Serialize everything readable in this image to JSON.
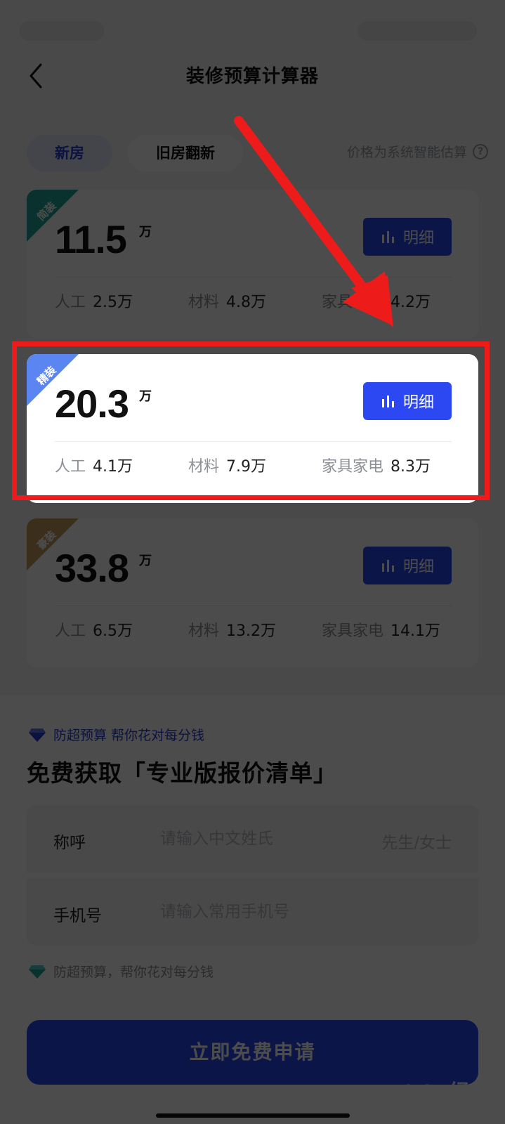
{
  "header": {
    "title": "装修预算计算器"
  },
  "tabs": [
    {
      "label": "新房"
    },
    {
      "label": "旧房翻新"
    }
  ],
  "hint": {
    "text": "价格为系统智能估算",
    "icon": "help-circle-icon"
  },
  "plans": [
    {
      "badge": "简装",
      "badge_color": "#1fa79d",
      "amount": "11.5",
      "unit": "万",
      "detail_label": "明细",
      "items": [
        {
          "label": "人工",
          "value": "2.5万"
        },
        {
          "label": "材料",
          "value": "4.8万"
        },
        {
          "label": "家具家电",
          "value": "4.2万"
        }
      ]
    },
    {
      "badge": "精装",
      "badge_color": "#5b86f2",
      "amount": "20.3",
      "unit": "万",
      "detail_label": "明细",
      "items": [
        {
          "label": "人工",
          "value": "4.1万"
        },
        {
          "label": "材料",
          "value": "7.9万"
        },
        {
          "label": "家具家电",
          "value": "8.3万"
        }
      ]
    },
    {
      "badge": "豪装",
      "badge_color": "#c59a5a",
      "amount": "33.8",
      "unit": "万",
      "detail_label": "明细",
      "items": [
        {
          "label": "人工",
          "value": "6.5万"
        },
        {
          "label": "材料",
          "value": "13.2万"
        },
        {
          "label": "家具家电",
          "value": "14.1万"
        }
      ]
    }
  ],
  "form": {
    "promo": "防超预算 帮你花对每分钱",
    "title": "免费获取「专业版报价清单」",
    "name": {
      "label": "称呼",
      "placeholder": "请输入中文姓氏",
      "gender": "先生/女士"
    },
    "phone": {
      "label": "手机号",
      "placeholder": "请输入常用手机号"
    },
    "promo2": "防超预算，帮你花对每分钱",
    "submit_label": "立即免费申请"
  },
  "watermark": {
    "main": "Bai du 经验",
    "sub": "jingyan.baidu.com"
  },
  "colors": {
    "accent": "#2b48f2",
    "highlight": "#ee1b1b",
    "tab_active_text": "#2b3dd6"
  }
}
